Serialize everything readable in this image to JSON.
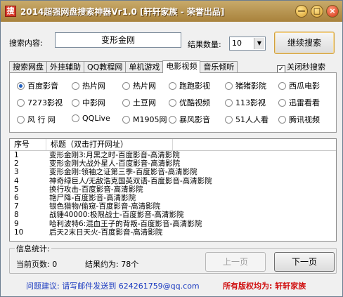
{
  "window": {
    "title": "2014超强网盘搜索神器Vr1.0  [轩轩家族 - 荣誉出品]",
    "icon_text": "搜",
    "minimize": "—",
    "maximize": "□",
    "close": "×"
  },
  "search": {
    "label": "搜索内容:",
    "value": "变形金刚",
    "count_label": "结果数量:",
    "count_value": "10",
    "submit_label": "继续搜索"
  },
  "tabs": [
    "搜索网盘",
    "外挂辅助",
    "QQ教程网",
    "单机游戏",
    "电影视频",
    "音乐倾听"
  ],
  "active_tab": 4,
  "close_seconds": {
    "label": "关闭秒搜索",
    "checked": true
  },
  "sites": [
    {
      "label": "百度影音",
      "selected": true
    },
    {
      "label": "热片网",
      "selected": false
    },
    {
      "label": "热片网",
      "selected": false
    },
    {
      "label": "跑跑影视",
      "selected": false
    },
    {
      "label": "猪猪影院",
      "selected": false
    },
    {
      "label": "西瓜电影",
      "selected": false
    },
    {
      "label": "7273影视",
      "selected": false
    },
    {
      "label": "中影网",
      "selected": false
    },
    {
      "label": "土豆网",
      "selected": false
    },
    {
      "label": "优酷视频",
      "selected": false
    },
    {
      "label": "113影视",
      "selected": false
    },
    {
      "label": "迅雷看看",
      "selected": false
    },
    {
      "label": "风 行 网",
      "selected": false
    },
    {
      "label": "QQLive",
      "selected": false
    },
    {
      "label": "M1905网",
      "selected": false
    },
    {
      "label": "暴风影音",
      "selected": false
    },
    {
      "label": "51人人看",
      "selected": false
    },
    {
      "label": "腾讯视频",
      "selected": false
    }
  ],
  "results": {
    "col_no": "序号",
    "col_title": "标题（双击打开网址）",
    "rows": [
      {
        "no": "1",
        "title": "变形金刚3:月黑之时-百度影音-高清影院"
      },
      {
        "no": "2",
        "title": "变形金刚大战外星人-百度影音-高清影院"
      },
      {
        "no": "3",
        "title": "变形金刚:领袖之证第三季-百度影音-高清影院"
      },
      {
        "no": "4",
        "title": "神奇绿巨人/无敌浩克国英双语-百度影音-高清影院"
      },
      {
        "no": "5",
        "title": "换行攻击-百度影音-高清影院"
      },
      {
        "no": "6",
        "title": "艳尸降-百度影音-高清影院"
      },
      {
        "no": "7",
        "title": "银色猎物/偷窥-百度影音-高清影院"
      },
      {
        "no": "8",
        "title": "战锤40000:极限战士-百度影音-高清影院"
      },
      {
        "no": "9",
        "title": "哈利波特6:混血王子的背叛-百度影音-高清影院"
      },
      {
        "no": "10",
        "title": "后天2末日天火-百度影音-高清影院"
      }
    ]
  },
  "stats": {
    "title": "信息统计:",
    "page_label": "当前页数: 0",
    "total_label": "结果约为: 78个",
    "prev": "上一页",
    "next": "下一页"
  },
  "footer": {
    "contact": "问题建议: 请写邮件发送到 624261759@qq.com",
    "copyright": "所有版权均为: 轩轩家族"
  }
}
